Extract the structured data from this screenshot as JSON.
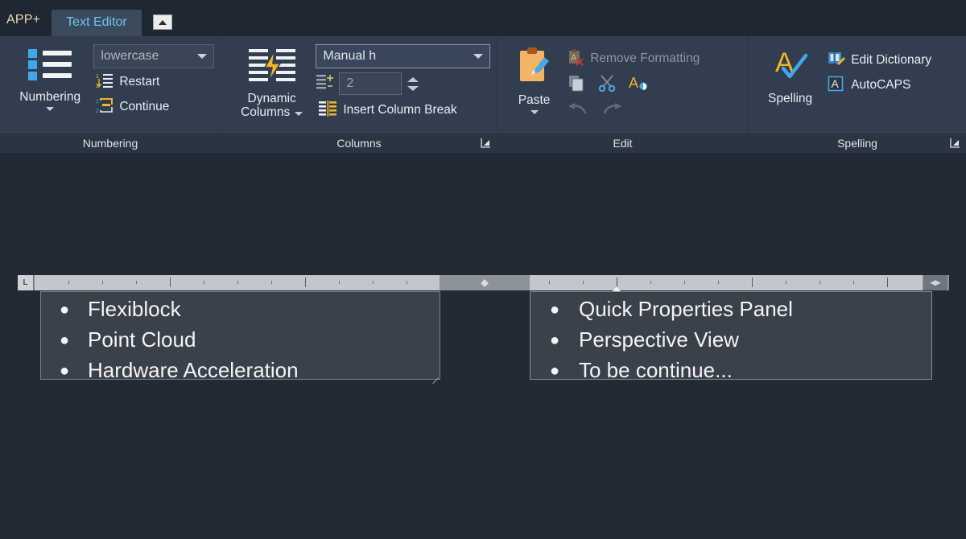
{
  "titlebar": {
    "app_menu": "APP+",
    "active_tab": "Text Editor",
    "minimize_icon": "collapse-ribbon-icon"
  },
  "ribbon": {
    "panels": [
      {
        "id": "numbering",
        "title": "Numbering",
        "big_button": {
          "label": "Numbering",
          "icon": "bulleted-list-icon",
          "has_dropdown": true
        },
        "combo": {
          "value": "lowercase",
          "icon": "chevron-down-icon"
        },
        "items": [
          {
            "label": "Restart",
            "icon": "restart-numbering-icon",
            "enabled": true
          },
          {
            "label": "Continue",
            "icon": "continue-numbering-icon",
            "enabled": true
          }
        ]
      },
      {
        "id": "columns",
        "title": "Columns",
        "has_dialog_launcher": true,
        "big_button": {
          "label": "Dynamic\nColumns",
          "label_line1": "Dynamic",
          "label_line2": "Columns",
          "icon": "dynamic-columns-icon",
          "has_dropdown": true
        },
        "combo": {
          "value": "Manual h",
          "icon": "chevron-down-icon"
        },
        "spinner": {
          "value": "2",
          "icon": "column-count-icon",
          "up_icon": "spinner-up-icon",
          "down_icon": "spinner-down-icon"
        },
        "items": [
          {
            "label": "Insert Column Break",
            "icon": "insert-column-break-icon",
            "enabled": true
          }
        ]
      },
      {
        "id": "edit",
        "title": "Edit",
        "big_button": {
          "label": "Paste",
          "icon": "paste-clipboard-icon",
          "has_dropdown": true
        },
        "items": [
          {
            "label": "Remove Formatting",
            "icon": "remove-formatting-icon",
            "enabled": false,
            "has_dropdown": true
          }
        ],
        "icon_row_1": [
          {
            "name": "copy-icon",
            "enabled": false
          },
          {
            "name": "cut-scissors-icon",
            "enabled": false
          },
          {
            "name": "match-properties-icon",
            "enabled": true
          }
        ],
        "icon_row_2": [
          {
            "name": "undo-arrow-icon",
            "enabled": false
          },
          {
            "name": "redo-arrow-icon",
            "enabled": false
          }
        ]
      },
      {
        "id": "spelling",
        "title": "Spelling",
        "has_dialog_launcher": true,
        "big_button": {
          "label": "Spelling",
          "icon": "spell-check-icon",
          "has_dropdown": false
        },
        "items": [
          {
            "label": "Edit Dictionary",
            "icon": "edit-dictionary-icon",
            "enabled": true
          },
          {
            "label": "AutoCAPS",
            "icon": "autocaps-icon",
            "enabled": true
          }
        ]
      }
    ]
  },
  "editor": {
    "ruler": {
      "tab_selector_glyph": "L",
      "scroll_icon": "horizontal-scroll-icon",
      "gap_marker_icon": "column-gap-marker-icon",
      "indent_marker_icon": "indent-marker-icon"
    },
    "columns": [
      {
        "id": "column-1",
        "bullet": "●",
        "lines": [
          "Flexiblock",
          "Point Cloud",
          "Hardware Acceleration"
        ]
      },
      {
        "id": "column-2",
        "bullet": "●",
        "lines": [
          "Quick Properties Panel",
          "Perspective View",
          "To be continue..."
        ]
      }
    ]
  },
  "colors": {
    "canvas_background": "#222a35",
    "ribbon_background": "#323e50",
    "panel_title_background": "#2b3443",
    "tab_text": "#6fc4f0",
    "app_menu_text": "#e8d9b0",
    "accent_gold": "#f0b429",
    "accent_blue": "#4aa7e0",
    "textbox_fill": "#3b414a",
    "ruler_fill": "#c3c6ca"
  }
}
